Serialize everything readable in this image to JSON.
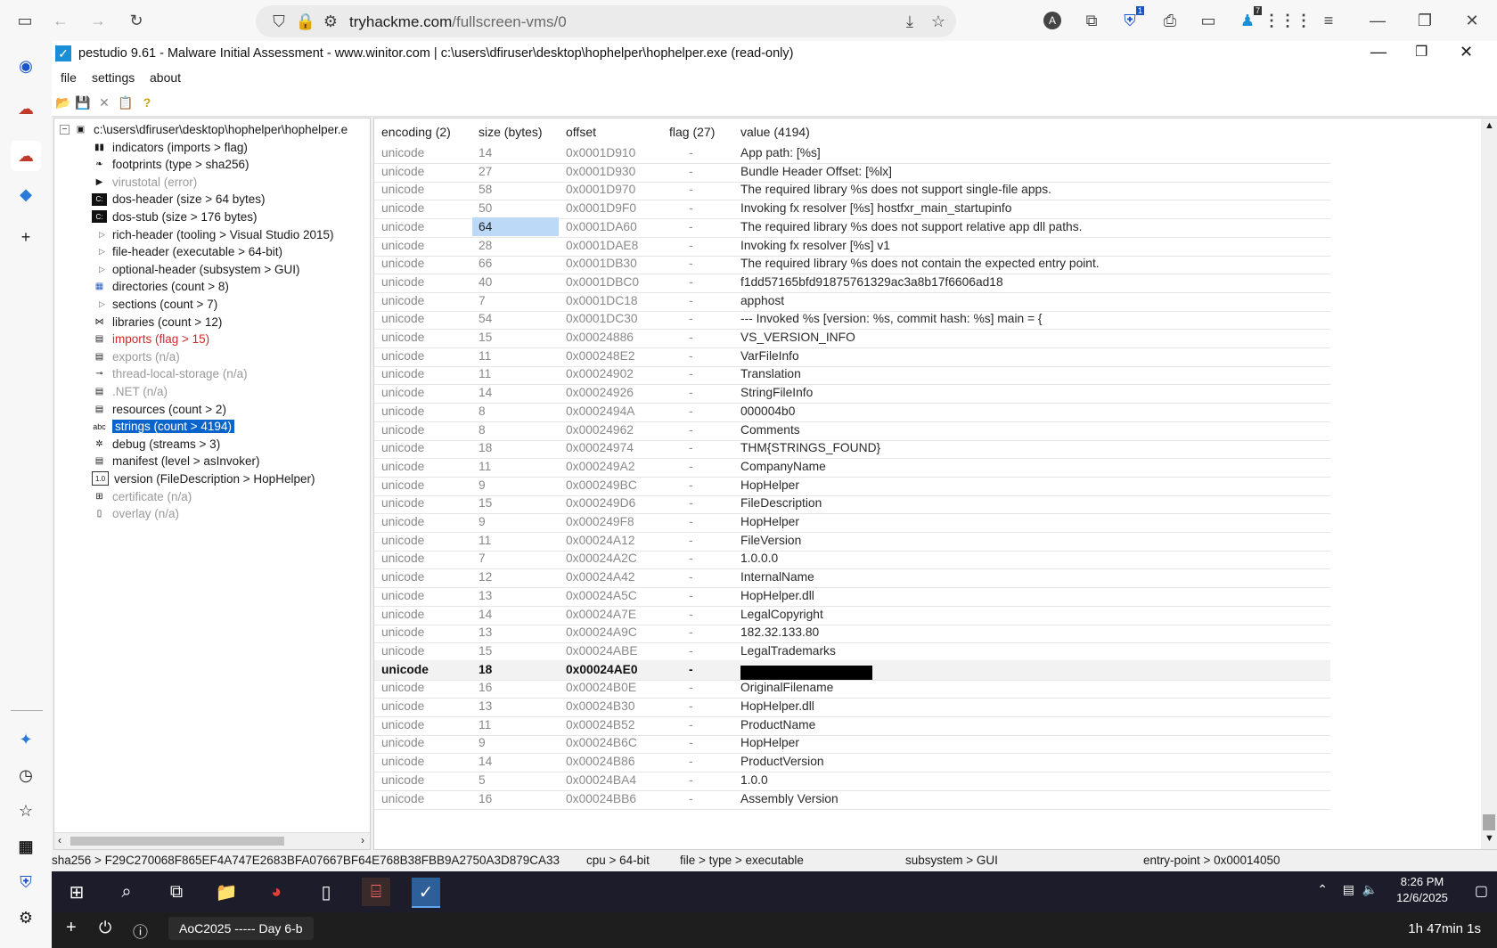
{
  "browser": {
    "url_domain": "tryhackme.com",
    "url_path": "/fullscreen-vms/0",
    "ext_badge_1": "1",
    "ext_badge_2": "7"
  },
  "app": {
    "title": "pestudio 9.61 - Malware Initial Assessment - www.winitor.com | c:\\users\\dfiruser\\desktop\\hophelper\\hophelper.exe (read-only)",
    "menu": [
      "file",
      "settings",
      "about"
    ]
  },
  "tree": {
    "root": "c:\\users\\dfiruser\\desktop\\hophelper\\hophelper.e",
    "items": [
      {
        "label": "indicators (imports > flag)",
        "icon": "bars-icon",
        "state": "normal"
      },
      {
        "label": "footprints (type > sha256)",
        "icon": "footprint-icon",
        "state": "normal"
      },
      {
        "label": "virustotal (error)",
        "icon": "virustotal-icon",
        "state": "gray"
      },
      {
        "label": "dos-header (size > 64 bytes)",
        "icon": "console-icon",
        "state": "normal"
      },
      {
        "label": "dos-stub (size > 176 bytes)",
        "icon": "console-icon",
        "state": "normal"
      },
      {
        "label": "rich-header (tooling > Visual Studio 2015)",
        "icon": "",
        "state": "normal",
        "expander": true
      },
      {
        "label": "file-header (executable > 64-bit)",
        "icon": "",
        "state": "normal",
        "expander": true
      },
      {
        "label": "optional-header (subsystem > GUI)",
        "icon": "",
        "state": "normal",
        "expander": true
      },
      {
        "label": "directories (count > 8)",
        "icon": "grid-icon",
        "state": "normal"
      },
      {
        "label": "sections (count > 7)",
        "icon": "",
        "state": "normal",
        "expander": true
      },
      {
        "label": "libraries (count > 12)",
        "icon": "share-icon",
        "state": "normal"
      },
      {
        "label": "imports (flag > 15)",
        "icon": "doc-icon",
        "state": "red"
      },
      {
        "label": "exports (n/a)",
        "icon": "doc-icon",
        "state": "gray"
      },
      {
        "label": "thread-local-storage (n/a)",
        "icon": "link-icon",
        "state": "gray"
      },
      {
        "label": ".NET (n/a)",
        "icon": "doc-icon",
        "state": "gray"
      },
      {
        "label": "resources (count > 2)",
        "icon": "doc-icon",
        "state": "normal"
      },
      {
        "label": "strings (count > 4194)",
        "icon": "abc-icon",
        "state": "selected"
      },
      {
        "label": "debug (streams > 3)",
        "icon": "bug-icon",
        "state": "normal"
      },
      {
        "label": "manifest (level > asInvoker)",
        "icon": "doc-icon",
        "state": "normal"
      },
      {
        "label": "version (FileDescription > HopHelper)",
        "icon": "version-icon",
        "state": "normal"
      },
      {
        "label": "certificate (n/a)",
        "icon": "cert-icon",
        "state": "gray"
      },
      {
        "label": "overlay (n/a)",
        "icon": "page-icon",
        "state": "gray"
      }
    ]
  },
  "table": {
    "headers": [
      "encoding (2)",
      "size (bytes)",
      "offset",
      "flag (27)",
      "value (4194)"
    ],
    "rows": [
      [
        "unicode",
        "14",
        "0x0001D910",
        "-",
        "App path: [%s]"
      ],
      [
        "unicode",
        "27",
        "0x0001D930",
        "-",
        "Bundle Header Offset: [%lx]"
      ],
      [
        "unicode",
        "58",
        "0x0001D970",
        "-",
        "The required library %s does not support single-file apps."
      ],
      [
        "unicode",
        "50",
        "0x0001D9F0",
        "-",
        "Invoking fx resolver [%s] hostfxr_main_startupinfo"
      ],
      [
        "unicode",
        "64",
        "0x0001DA60",
        "-",
        "The required library %s does not support relative app dll paths."
      ],
      [
        "unicode",
        "28",
        "0x0001DAE8",
        "-",
        "Invoking fx resolver [%s] v1"
      ],
      [
        "unicode",
        "66",
        "0x0001DB30",
        "-",
        "The required library %s does not contain the expected entry point."
      ],
      [
        "unicode",
        "40",
        "0x0001DBC0",
        "-",
        "f1dd57165bfd91875761329ac3a8b17f6606ad18"
      ],
      [
        "unicode",
        "7",
        "0x0001DC18",
        "-",
        "apphost"
      ],
      [
        "unicode",
        "54",
        "0x0001DC30",
        "-",
        "--- Invoked %s [version: %s, commit hash: %s] main = {"
      ],
      [
        "unicode",
        "15",
        "0x00024886",
        "-",
        "VS_VERSION_INFO"
      ],
      [
        "unicode",
        "11",
        "0x000248E2",
        "-",
        "VarFileInfo"
      ],
      [
        "unicode",
        "11",
        "0x00024902",
        "-",
        "Translation"
      ],
      [
        "unicode",
        "14",
        "0x00024926",
        "-",
        "StringFileInfo"
      ],
      [
        "unicode",
        "8",
        "0x0002494A",
        "-",
        "000004b0"
      ],
      [
        "unicode",
        "8",
        "0x00024962",
        "-",
        "Comments"
      ],
      [
        "unicode",
        "18",
        "0x00024974",
        "-",
        "THM{STRINGS_FOUND}"
      ],
      [
        "unicode",
        "11",
        "0x000249A2",
        "-",
        "CompanyName"
      ],
      [
        "unicode",
        "9",
        "0x000249BC",
        "-",
        "HopHelper"
      ],
      [
        "unicode",
        "15",
        "0x000249D6",
        "-",
        "FileDescription"
      ],
      [
        "unicode",
        "9",
        "0x000249F8",
        "-",
        "HopHelper"
      ],
      [
        "unicode",
        "11",
        "0x00024A12",
        "-",
        "FileVersion"
      ],
      [
        "unicode",
        "7",
        "0x00024A2C",
        "-",
        "1.0.0.0"
      ],
      [
        "unicode",
        "12",
        "0x00024A42",
        "-",
        "InternalName"
      ],
      [
        "unicode",
        "13",
        "0x00024A5C",
        "-",
        "HopHelper.dll"
      ],
      [
        "unicode",
        "14",
        "0x00024A7E",
        "-",
        "LegalCopyright"
      ],
      [
        "unicode",
        "13",
        "0x00024A9C",
        "-",
        "182.32.133.80"
      ],
      [
        "unicode",
        "15",
        "0x00024ABE",
        "-",
        "LegalTrademarks"
      ],
      [
        "unicode",
        "18",
        "0x00024AE0",
        "-",
        ""
      ],
      [
        "unicode",
        "16",
        "0x00024B0E",
        "-",
        "OriginalFilename"
      ],
      [
        "unicode",
        "13",
        "0x00024B30",
        "-",
        "HopHelper.dll"
      ],
      [
        "unicode",
        "11",
        "0x00024B52",
        "-",
        "ProductName"
      ],
      [
        "unicode",
        "9",
        "0x00024B6C",
        "-",
        "HopHelper"
      ],
      [
        "unicode",
        "14",
        "0x00024B86",
        "-",
        "ProductVersion"
      ],
      [
        "unicode",
        "5",
        "0x00024BA4",
        "-",
        "1.0.0"
      ],
      [
        "unicode",
        "16",
        "0x00024BB6",
        "-",
        "Assembly Version"
      ]
    ],
    "highlighted_cell_row": 4,
    "bold_row": 28,
    "redacted_row": 28
  },
  "status": {
    "sha256": "sha256 > F29C270068F865EF4A747E2683BFA07667BF64E768B38FBB9A2750A3D879CA33",
    "cpu": "cpu > 64-bit",
    "file_type": "file > type > executable",
    "subsystem": "subsystem > GUI",
    "entry_point": "entry-point > 0x00014050"
  },
  "taskbar": {
    "time": "8:26 PM",
    "date": "12/6/2025"
  },
  "bottom_bar": {
    "session_label": "AoC2025 ----- Day 6-b",
    "timer": "1h 47min 1s"
  },
  "colors": {
    "selection": "#0a64cc",
    "red_item": "#cc2b2b",
    "taskbar": "#1c1c2b"
  }
}
